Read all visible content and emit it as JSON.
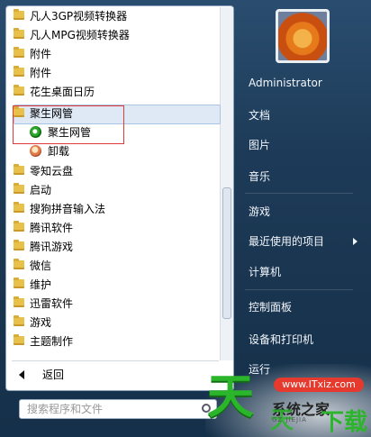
{
  "programs": [
    {
      "label": "凡人3GP视频转换器",
      "type": "folder"
    },
    {
      "label": "凡人MPG视频转换器",
      "type": "folder"
    },
    {
      "label": "附件",
      "type": "folder"
    },
    {
      "label": "附件",
      "type": "folder"
    },
    {
      "label": "花生桌面日历",
      "type": "folder"
    },
    {
      "label": "聚生网管",
      "type": "folder",
      "selected": true
    },
    {
      "label": "聚生网管",
      "type": "app"
    },
    {
      "label": "卸载",
      "type": "app"
    },
    {
      "label": "零知云盘",
      "type": "folder"
    },
    {
      "label": "启动",
      "type": "folder"
    },
    {
      "label": "搜狗拼音输入法",
      "type": "folder"
    },
    {
      "label": "腾讯软件",
      "type": "folder"
    },
    {
      "label": "腾讯游戏",
      "type": "folder"
    },
    {
      "label": "微信",
      "type": "folder"
    },
    {
      "label": "维护",
      "type": "folder"
    },
    {
      "label": "迅雷软件",
      "type": "folder"
    },
    {
      "label": "游戏",
      "type": "folder"
    },
    {
      "label": "主题制作",
      "type": "folder"
    }
  ],
  "back_label": "返回",
  "search_placeholder": "搜索程序和文件",
  "right_menu": {
    "user": "Administrator",
    "documents": "文档",
    "pictures": "图片",
    "music": "音乐",
    "games": "游戏",
    "recent": "最近使用的项目",
    "computer": "计算机",
    "control_panel": "控制面板",
    "devices": "设备和打印机",
    "run": "运行"
  },
  "watermark": {
    "big": "天",
    "url": "www.ITxiz.com",
    "sub1": "系统之家",
    "green2": "天",
    "download": "下载",
    "sub2": "GZ JIEJIA"
  },
  "colors": {
    "accent_green": "#2bb52b",
    "selection_red": "#e03a3a",
    "folder": "#e8c14a"
  }
}
